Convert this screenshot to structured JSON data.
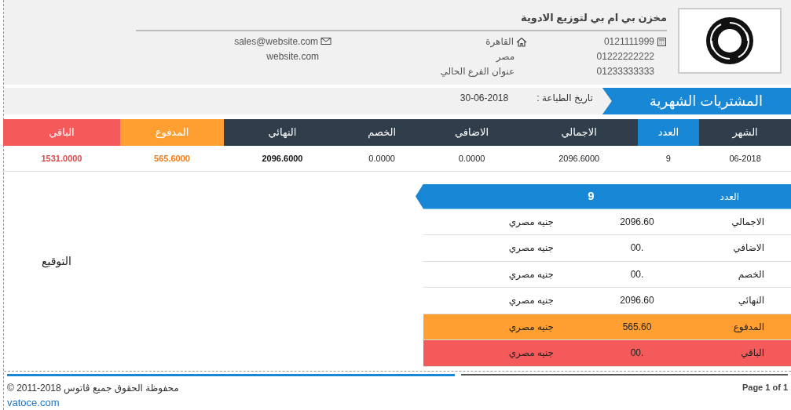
{
  "company": {
    "name": "مخزن بي ام بي لتوزيع الادوية",
    "phones": [
      "0121111999",
      "01222222222",
      "01233333333"
    ],
    "address": [
      "القاهرة",
      "مصر",
      "عنوان الفرع الحالي"
    ],
    "web": [
      "sales@website.com",
      "website.com"
    ]
  },
  "report": {
    "title": "المشتريات الشهرية",
    "print_date_label": "تاريخ الطباعة :",
    "print_date": "30-06-2018"
  },
  "table": {
    "columns": [
      {
        "label": "الشهر",
        "kind": "normal"
      },
      {
        "label": "العدد",
        "kind": "highlight"
      },
      {
        "label": "الاجمالي",
        "kind": "normal"
      },
      {
        "label": "الاضافي",
        "kind": "normal"
      },
      {
        "label": "الخصم",
        "kind": "normal"
      },
      {
        "label": "النهائي",
        "kind": "total"
      },
      {
        "label": "المدفوع",
        "kind": "paid"
      },
      {
        "label": "الباقي",
        "kind": "remaining"
      }
    ],
    "rows": [
      [
        "06-2018",
        "9",
        "2096.6000",
        "0.0000",
        "0.0000",
        "2096.6000",
        "565.6000",
        "1531.0000"
      ]
    ]
  },
  "signature": "التوقيع",
  "summary": {
    "header_label": "العدد",
    "header_value": "9",
    "rows": [
      {
        "label": "الاجمالي",
        "value": "2096.60",
        "currency": "جنيه مصري",
        "kind": "normal"
      },
      {
        "label": "الاضافي",
        "value": ".00",
        "currency": "جنيه مصري",
        "kind": "normal"
      },
      {
        "label": "الخصم",
        "value": ".00",
        "currency": "جنيه مصري",
        "kind": "normal"
      },
      {
        "label": "النهائي",
        "value": "2096.60",
        "currency": "جنيه مصري",
        "kind": "normal"
      },
      {
        "label": "المدفوع",
        "value": "565.60",
        "currency": "جنيه مصري",
        "kind": "paid"
      },
      {
        "label": "الباقي",
        "value": ".00",
        "currency": "جنيه مصري",
        "kind": "remaining"
      }
    ]
  },
  "footer": {
    "page": "Page 1 of 1",
    "copyright": "© 2011-2018 محفوظة الحقوق جميع ڤاتوس",
    "link": "vatoce.com"
  }
}
